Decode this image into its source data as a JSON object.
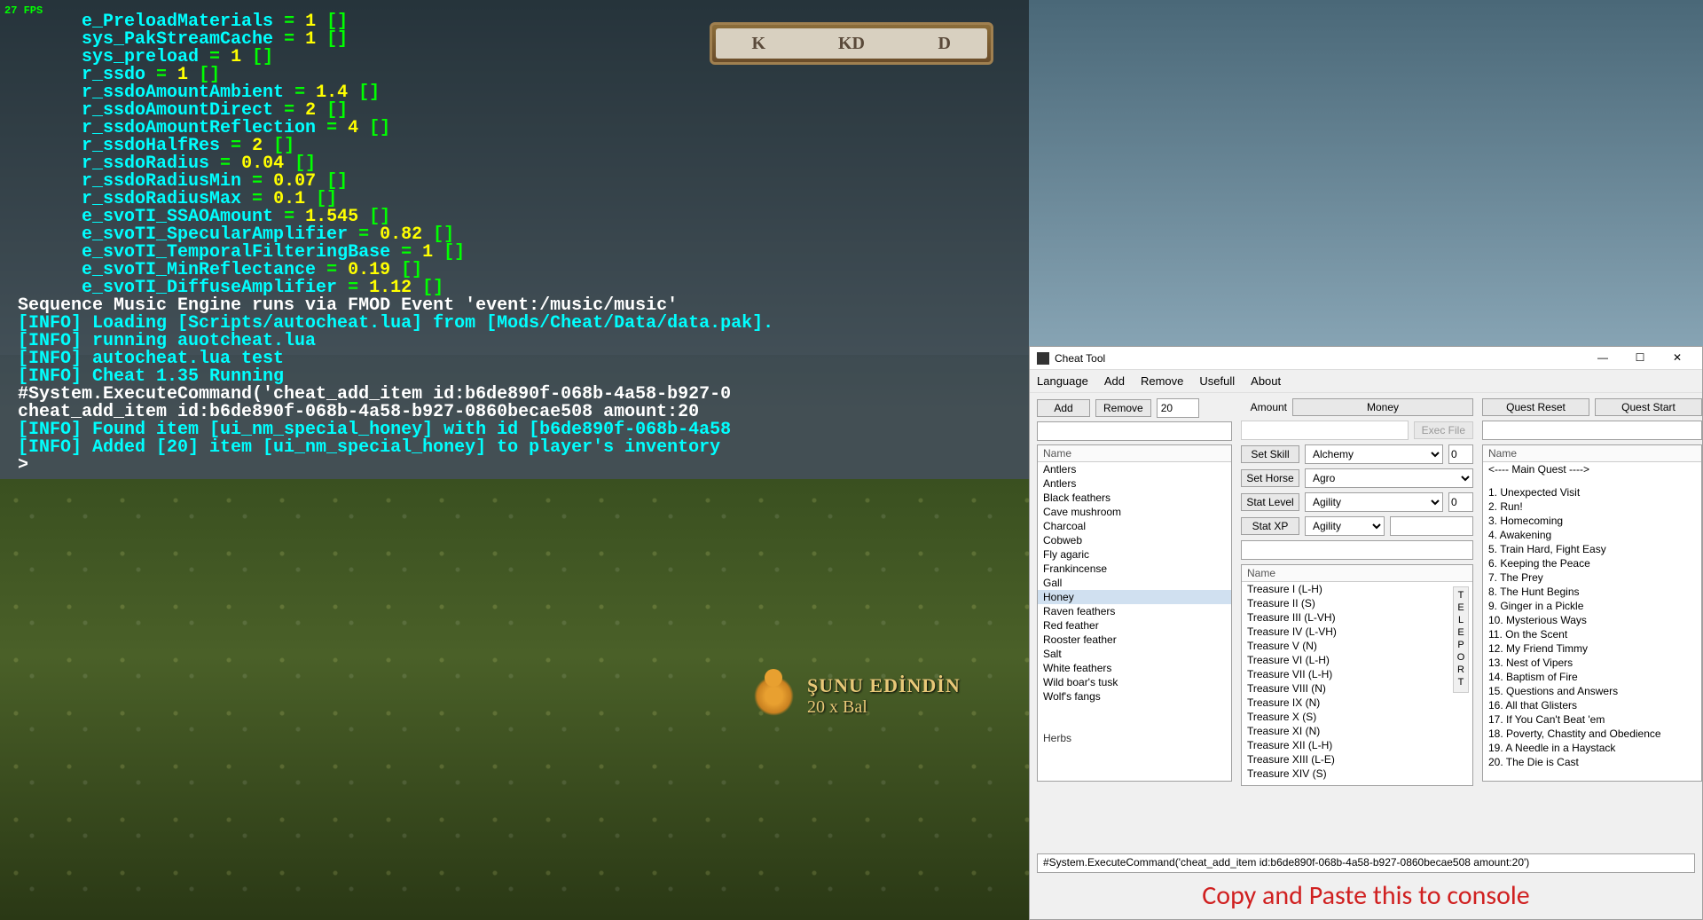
{
  "fps": "27 FPS",
  "hud": {
    "k": "K",
    "kd": "KD",
    "d": "D"
  },
  "console": {
    "lines": [
      {
        "indent": 6,
        "segs": [
          [
            "e_PreloadMaterials ",
            "c-cyan"
          ],
          [
            "= ",
            "c-green"
          ],
          [
            "1 ",
            "c-yellow"
          ],
          [
            "[]",
            "c-green"
          ]
        ]
      },
      {
        "indent": 6,
        "segs": [
          [
            "sys_PakStreamCache ",
            "c-cyan"
          ],
          [
            "= ",
            "c-green"
          ],
          [
            "1 ",
            "c-yellow"
          ],
          [
            "[]",
            "c-green"
          ]
        ]
      },
      {
        "indent": 6,
        "segs": [
          [
            "sys_preload ",
            "c-cyan"
          ],
          [
            "= ",
            "c-green"
          ],
          [
            "1 ",
            "c-yellow"
          ],
          [
            "[]",
            "c-green"
          ]
        ]
      },
      {
        "indent": 6,
        "segs": [
          [
            "r_ssdo ",
            "c-cyan"
          ],
          [
            "= ",
            "c-green"
          ],
          [
            "1 ",
            "c-yellow"
          ],
          [
            "[]",
            "c-green"
          ]
        ]
      },
      {
        "indent": 6,
        "segs": [
          [
            "r_ssdoAmountAmbient ",
            "c-cyan"
          ],
          [
            "= ",
            "c-green"
          ],
          [
            "1.4 ",
            "c-yellow"
          ],
          [
            "[]",
            "c-green"
          ]
        ]
      },
      {
        "indent": 6,
        "segs": [
          [
            "r_ssdoAmountDirect ",
            "c-cyan"
          ],
          [
            "= ",
            "c-green"
          ],
          [
            "2 ",
            "c-yellow"
          ],
          [
            "[]",
            "c-green"
          ]
        ]
      },
      {
        "indent": 6,
        "segs": [
          [
            "r_ssdoAmountReflection ",
            "c-cyan"
          ],
          [
            "= ",
            "c-green"
          ],
          [
            "4 ",
            "c-yellow"
          ],
          [
            "[]",
            "c-green"
          ]
        ]
      },
      {
        "indent": 6,
        "segs": [
          [
            "r_ssdoHalfRes ",
            "c-cyan"
          ],
          [
            "= ",
            "c-green"
          ],
          [
            "2 ",
            "c-yellow"
          ],
          [
            "[]",
            "c-green"
          ]
        ]
      },
      {
        "indent": 6,
        "segs": [
          [
            "r_ssdoRadius ",
            "c-cyan"
          ],
          [
            "= ",
            "c-green"
          ],
          [
            "0.04 ",
            "c-yellow"
          ],
          [
            "[]",
            "c-green"
          ]
        ]
      },
      {
        "indent": 6,
        "segs": [
          [
            "r_ssdoRadiusMin ",
            "c-cyan"
          ],
          [
            "= ",
            "c-green"
          ],
          [
            "0.07 ",
            "c-yellow"
          ],
          [
            "[]",
            "c-green"
          ]
        ]
      },
      {
        "indent": 6,
        "segs": [
          [
            "r_ssdoRadiusMax ",
            "c-cyan"
          ],
          [
            "= ",
            "c-green"
          ],
          [
            "0.1 ",
            "c-yellow"
          ],
          [
            "[]",
            "c-green"
          ]
        ]
      },
      {
        "indent": 6,
        "segs": [
          [
            "e_svoTI_SSAOAmount ",
            "c-cyan"
          ],
          [
            "= ",
            "c-green"
          ],
          [
            "1.545 ",
            "c-yellow"
          ],
          [
            "[]",
            "c-green"
          ]
        ]
      },
      {
        "indent": 6,
        "segs": [
          [
            "e_svoTI_SpecularAmplifier ",
            "c-cyan"
          ],
          [
            "= ",
            "c-green"
          ],
          [
            "0.82 ",
            "c-yellow"
          ],
          [
            "[]",
            "c-green"
          ]
        ]
      },
      {
        "indent": 6,
        "segs": [
          [
            "e_svoTI_TemporalFilteringBase ",
            "c-cyan"
          ],
          [
            "= ",
            "c-green"
          ],
          [
            "1 ",
            "c-yellow"
          ],
          [
            "[]",
            "c-green"
          ]
        ]
      },
      {
        "indent": 6,
        "segs": [
          [
            "e_svoTI_MinReflectance ",
            "c-cyan"
          ],
          [
            "= ",
            "c-green"
          ],
          [
            "0.19 ",
            "c-yellow"
          ],
          [
            "[]",
            "c-green"
          ]
        ]
      },
      {
        "indent": 6,
        "segs": [
          [
            "e_svoTI_DiffuseAmplifier ",
            "c-cyan"
          ],
          [
            "= ",
            "c-green"
          ],
          [
            "1.12 ",
            "c-yellow"
          ],
          [
            "[]",
            "c-green"
          ]
        ]
      },
      {
        "indent": 0,
        "segs": [
          [
            "Sequence Music Engine runs via FMOD Event 'event:/music/music'",
            "c-white"
          ]
        ]
      },
      {
        "indent": 0,
        "segs": [
          [
            "[INFO] Loading [Scripts/autocheat.lua] from [Mods/Cheat/Data/data.pak].",
            "c-cyan"
          ]
        ]
      },
      {
        "indent": 0,
        "segs": [
          [
            "[INFO] running auotcheat.lua",
            "c-cyan"
          ]
        ]
      },
      {
        "indent": 0,
        "segs": [
          [
            "[INFO] autocheat.lua test",
            "c-cyan"
          ]
        ]
      },
      {
        "indent": 0,
        "segs": [
          [
            "[INFO] Cheat 1.35 Running",
            "c-cyan"
          ]
        ]
      },
      {
        "indent": 0,
        "segs": [
          [
            "#System.ExecuteCommand('cheat_add_item id:b6de890f-068b-4a58-b927-0",
            "c-white"
          ]
        ]
      },
      {
        "indent": 0,
        "segs": [
          [
            "cheat_add_item id:b6de890f-068b-4a58-b927-0860becae508 amount:20",
            "c-white"
          ]
        ]
      },
      {
        "indent": 0,
        "segs": [
          [
            "[INFO] Found item [ui_nm_special_honey] with id [b6de890f-068b-4a58",
            "c-cyan"
          ]
        ]
      },
      {
        "indent": 0,
        "segs": [
          [
            "[INFO] Added [20] item [ui_nm_special_honey] to player's inventory",
            "c-cyan"
          ]
        ]
      },
      {
        "indent": 0,
        "segs": [
          [
            ">",
            "c-white"
          ]
        ]
      }
    ]
  },
  "loot": {
    "title": "ŞUNU EDİNDİN",
    "sub": "20 x Bal"
  },
  "cheat": {
    "title": "Cheat Tool",
    "menu": [
      "Language",
      "Add",
      "Remove",
      "Usefull",
      "About"
    ],
    "buttons": {
      "add": "Add",
      "remove": "Remove",
      "amount": "20",
      "questReset": "Quest Reset",
      "questStart": "Quest Start",
      "money": "Money",
      "execFile": "Exec File",
      "setSkill": "Set Skill",
      "setHorse": "Set Horse",
      "statLevel": "Stat Level",
      "statXP": "Stat XP"
    },
    "labels": {
      "amount": "Amount",
      "name1": "Name",
      "name2": "Name",
      "name3": "Name"
    },
    "dropdowns": {
      "skill": "Alchemy",
      "horse": "Agro",
      "level": "Agility",
      "xp": "Agility"
    },
    "spins": {
      "skill": "0",
      "level": "0"
    },
    "items": [
      "Antlers",
      "Antlers",
      "Black feathers",
      "Cave mushroom",
      "Charcoal",
      "Cobweb",
      "Fly agaric",
      "Frankincense",
      "Gall",
      "Honey",
      "Raven feathers",
      "Red feather",
      "Rooster feather",
      "Salt",
      "White feathers",
      "Wild boar's tusk",
      "Wolf's fangs"
    ],
    "itemsCategory": "Herbs",
    "itemsSelected": "Honey",
    "treasures": [
      "Treasure I (L-H)",
      "Treasure II (S)",
      "Treasure III (L-VH)",
      "Treasure IV (L-VH)",
      "Treasure V (N)",
      "Treasure VI (L-H)",
      "Treasure VII (L-H)",
      "Treasure VIII (N)",
      "Treasure IX (N)",
      "Treasure X (S)",
      "Treasure XI (N)",
      "Treasure XII (L-H)",
      "Treasure XIII (L-E)",
      "Treasure XIV (S)"
    ],
    "questHeader": "<---- Main Quest ---->",
    "quests": [
      "1. Unexpected Visit",
      "2. Run!",
      "3. Homecoming",
      "4. Awakening",
      "5. Train Hard, Fight Easy",
      "6. Keeping the Peace",
      "7. The Prey",
      "8. The Hunt Begins",
      "9. Ginger in a Pickle",
      "10. Mysterious Ways",
      "11. On the Scent",
      "12. My Friend Timmy",
      "13. Nest of Vipers",
      "14. Baptism of Fire",
      "15. Questions and Answers",
      "16. All that Glisters",
      "17. If You Can't Beat 'em",
      "18. Poverty, Chastity and Obedience",
      "19. A Needle in a Haystack",
      "20. The Die is Cast"
    ],
    "teleport": "TELEPORT",
    "command": "#System.ExecuteCommand('cheat_add_item id:b6de890f-068b-4a58-b927-0860becae508 amount:20')",
    "instruction": "Copy and Paste this to console"
  }
}
